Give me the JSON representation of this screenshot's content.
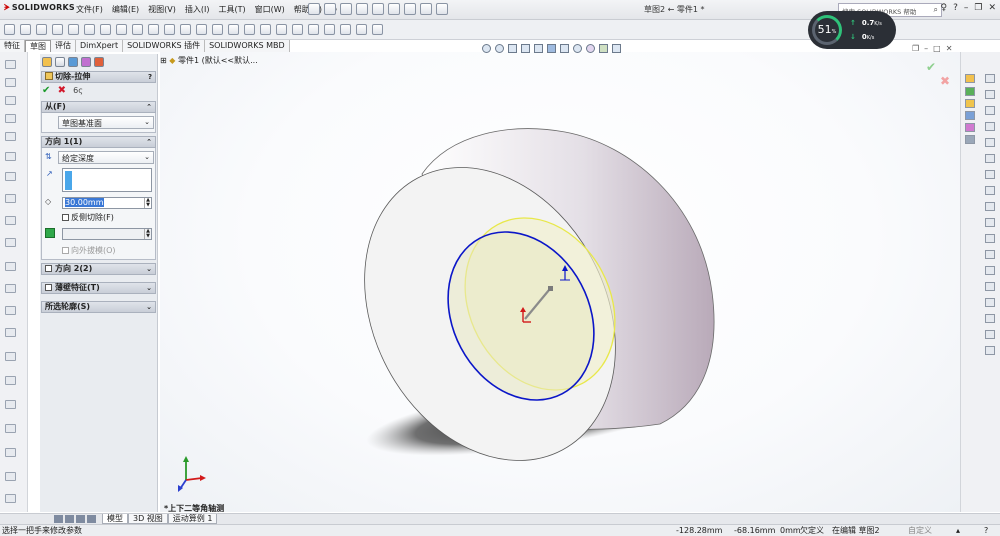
{
  "app": {
    "logo_text": "SOLIDWORKS",
    "document_title": "草图2 ← 零件1 *"
  },
  "menu": [
    "文件(F)",
    "编辑(E)",
    "视图(V)",
    "插入(I)",
    "工具(T)",
    "窗口(W)",
    "帮助(H)"
  ],
  "search": {
    "placeholder": "搜索 SOLIDWORKS 帮助"
  },
  "perf": {
    "percent": "51",
    "percent_unit": "%",
    "up_rate": "0.7",
    "down_rate": "0",
    "rate_unit": "K/s"
  },
  "command_tabs": [
    "特征",
    "草图",
    "评估",
    "DimXpert",
    "SOLIDWORKS 插件",
    "SOLIDWORKS MBD"
  ],
  "property_manager": {
    "title": "切除-拉伸",
    "from": {
      "label": "从(F)",
      "value": "草图基准面"
    },
    "direction1": {
      "label": "方向 1(1)",
      "end_condition": "给定深度",
      "depth": "30.00mm",
      "flip_side_label": "反侧切除(F)",
      "draft_outward_label": "向外拔模(O)"
    },
    "direction2": {
      "label": "方向 2(2)"
    },
    "thin_feature": {
      "label": "薄壁特征(T)"
    },
    "selected_contours": {
      "label": "所选轮廓(S)"
    }
  },
  "viewport": {
    "tree_root": "零件1 (默认<<默认...",
    "view_name": "*上下二等角轴测",
    "colors": {
      "sketch_circle": "#0b16c8",
      "preview_circle": "#e8e84a",
      "preview_fill": "#eeeec8",
      "body_face": "#f3f3f3"
    }
  },
  "bottom_tabs": [
    "模型",
    "3D 视图",
    "运动算例 1"
  ],
  "status": {
    "hint": "选择一把手来修改参数",
    "x": "-128.28mm",
    "y": "-68.16mm",
    "z": "0mm",
    "state": "欠定义",
    "editing": "在编辑 草图2",
    "custom": "自定义"
  }
}
